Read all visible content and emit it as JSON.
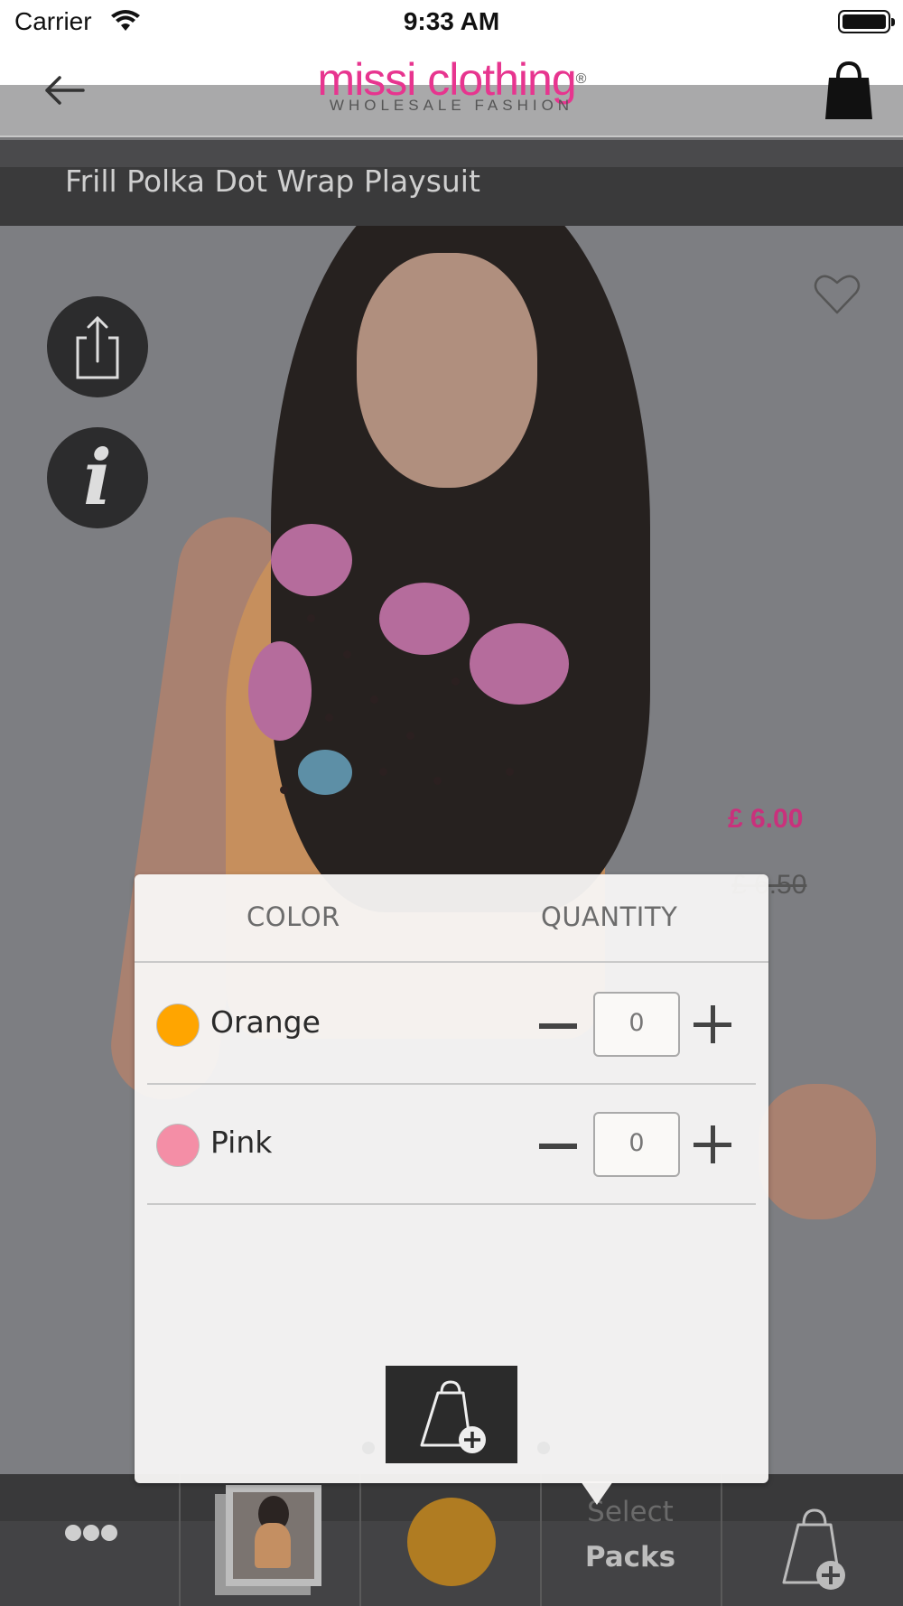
{
  "status_bar": {
    "carrier": "Carrier",
    "time": "9:33 AM"
  },
  "header": {
    "logo_main": "missi clothing",
    "logo_registered": "®",
    "logo_sub": "WHOLESALE FASHION"
  },
  "product": {
    "title": "Frill Polka Dot Wrap Playsuit",
    "price": "£ 6.00",
    "old_price": "£ 6.50"
  },
  "popup": {
    "color_header": "COLOR",
    "quantity_header": "QUANTITY",
    "rows": [
      {
        "color_name": "Orange",
        "swatch": "#ffa500",
        "quantity": "0"
      },
      {
        "color_name": "Pink",
        "swatch": "#f48ea6",
        "quantity": "0"
      }
    ]
  },
  "bottom_bar": {
    "selected_color": "#b07c22",
    "select_label": "Select",
    "packs_label": "Packs"
  },
  "colors": {
    "brand_pink": "#e7358f",
    "price_pink": "#c9317c"
  }
}
